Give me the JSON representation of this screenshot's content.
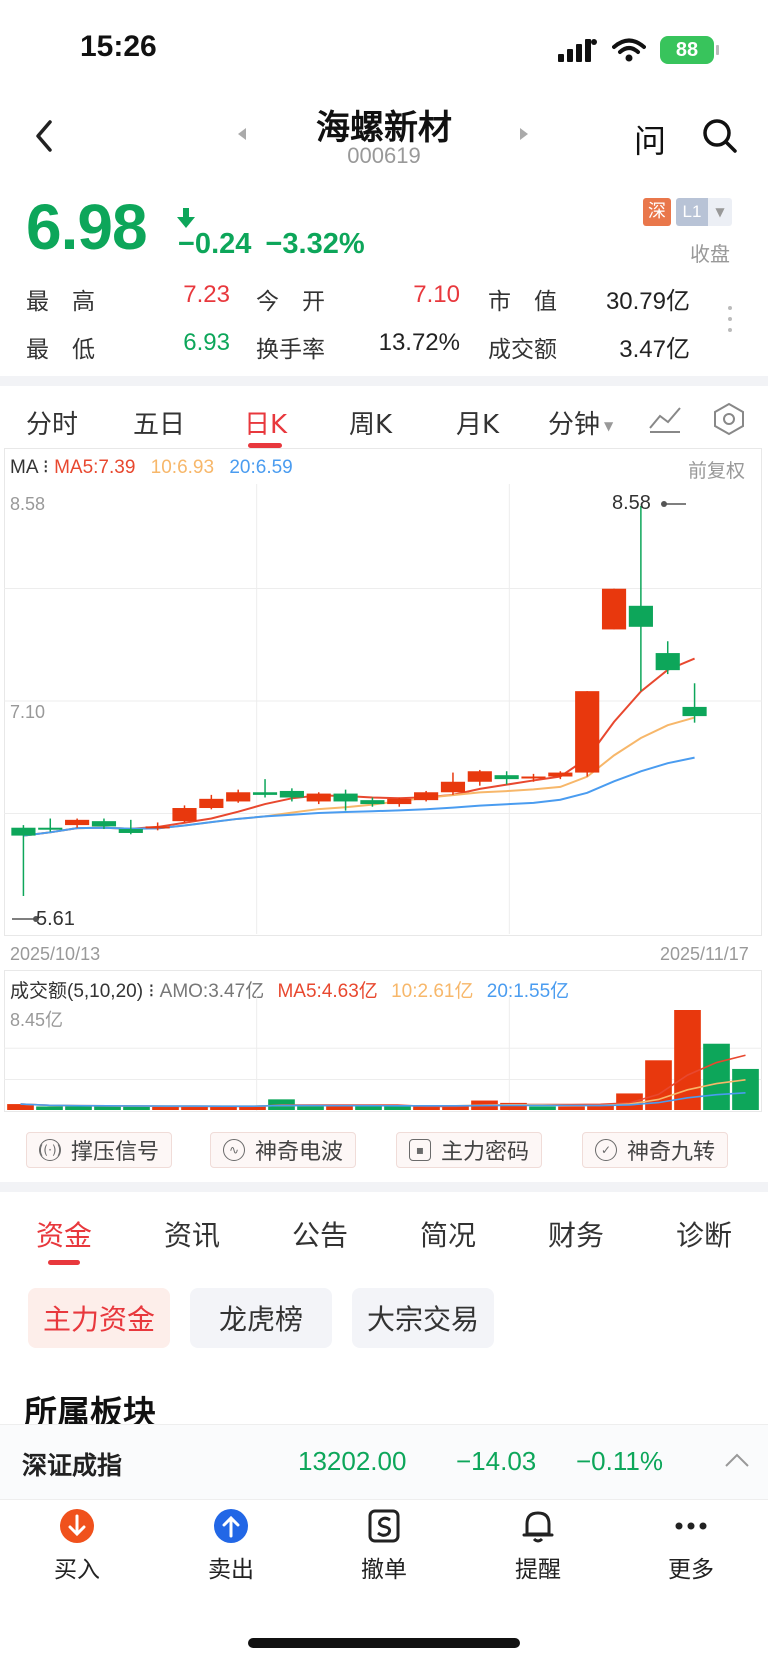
{
  "status_bar": {
    "time": "15:26",
    "battery": "88"
  },
  "nav": {
    "title": "海螺新材",
    "code": "000619",
    "ask_label": "问"
  },
  "quote": {
    "price": "6.98",
    "change": "−0.24",
    "change_pct": "−3.32%",
    "exchange_badge": "深",
    "level_badge": "L1",
    "status": "收盘",
    "stats": {
      "high_label": "最　高",
      "high": "7.23",
      "open_label": "今　开",
      "open": "7.10",
      "mktcap_label": "市　值",
      "mktcap": "30.79亿",
      "low_label": "最　低",
      "low": "6.93",
      "turnover_label": "换手率",
      "turnover": "13.72%",
      "amount_label": "成交额",
      "amount": "3.47亿"
    }
  },
  "chart_tabs": [
    "分时",
    "五日",
    "日K",
    "周K",
    "月K",
    "分钟"
  ],
  "chart": {
    "ma_label": "MA",
    "ma5": "MA5:7.39",
    "ma10": "10:6.93",
    "ma20": "20:6.59",
    "adjust": "前复权",
    "y_top": "8.58",
    "y_mid": "7.10",
    "max_mark": "8.58",
    "min_mark": "5.61",
    "date_start": "2025/10/13",
    "date_end": "2025/11/17"
  },
  "volume": {
    "title": "成交额(5,10,20)",
    "amo": "AMO:3.47亿",
    "ma5": "MA5:4.63亿",
    "ma10": "10:2.61亿",
    "ma20": "20:1.55亿",
    "y_top": "8.45亿"
  },
  "chips": [
    "撑压信号",
    "神奇电波",
    "主力密码",
    "神奇九转"
  ],
  "section_tabs": [
    "资金",
    "资讯",
    "公告",
    "简况",
    "财务",
    "诊断"
  ],
  "sub_tabs": [
    "主力资金",
    "龙虎榜",
    "大宗交易"
  ],
  "section_title": "所属板块",
  "index_bar": {
    "name": "深证成指",
    "value": "13202.00",
    "change": "−14.03",
    "change_pct": "−0.11%"
  },
  "bottom_actions": [
    "买入",
    "卖出",
    "撤单",
    "提醒",
    "更多"
  ],
  "colors": {
    "up": "#e8380d",
    "down": "#0da65a",
    "ma5": "#e8482f",
    "ma10": "#f7b76a",
    "ma20": "#4a9cf0"
  },
  "chart_data": {
    "type": "candlestick",
    "x_start": "2025/10/13",
    "x_end": "2025/11/17",
    "ylim": [
      5.61,
      8.58
    ],
    "candles": [
      {
        "o": 6.13,
        "c": 6.07,
        "h": 6.15,
        "l": 5.61,
        "dir": "down"
      },
      {
        "o": 6.13,
        "c": 6.12,
        "h": 6.2,
        "l": 6.1,
        "dir": "down"
      },
      {
        "o": 6.15,
        "c": 6.19,
        "h": 6.2,
        "l": 6.13,
        "dir": "up"
      },
      {
        "o": 6.18,
        "c": 6.14,
        "h": 6.2,
        "l": 6.12,
        "dir": "down"
      },
      {
        "o": 6.12,
        "c": 6.09,
        "h": 6.19,
        "l": 6.08,
        "dir": "down"
      },
      {
        "o": 6.13,
        "c": 6.14,
        "h": 6.17,
        "l": 6.11,
        "dir": "up"
      },
      {
        "o": 6.18,
        "c": 6.28,
        "h": 6.3,
        "l": 6.17,
        "dir": "up"
      },
      {
        "o": 6.28,
        "c": 6.35,
        "h": 6.38,
        "l": 6.27,
        "dir": "up"
      },
      {
        "o": 6.33,
        "c": 6.4,
        "h": 6.42,
        "l": 6.32,
        "dir": "up"
      },
      {
        "o": 6.4,
        "c": 6.38,
        "h": 6.5,
        "l": 6.36,
        "dir": "down"
      },
      {
        "o": 6.41,
        "c": 6.36,
        "h": 6.43,
        "l": 6.33,
        "dir": "down"
      },
      {
        "o": 6.33,
        "c": 6.39,
        "h": 6.4,
        "l": 6.31,
        "dir": "up"
      },
      {
        "o": 6.39,
        "c": 6.33,
        "h": 6.42,
        "l": 6.26,
        "dir": "down"
      },
      {
        "o": 6.31,
        "c": 6.34,
        "h": 6.36,
        "l": 6.29,
        "dir": "down"
      },
      {
        "o": 6.31,
        "c": 6.35,
        "h": 6.36,
        "l": 6.29,
        "dir": "up"
      },
      {
        "o": 6.34,
        "c": 6.4,
        "h": 6.41,
        "l": 6.33,
        "dir": "up"
      },
      {
        "o": 6.4,
        "c": 6.48,
        "h": 6.55,
        "l": 6.38,
        "dir": "up"
      },
      {
        "o": 6.48,
        "c": 6.56,
        "h": 6.57,
        "l": 6.45,
        "dir": "up"
      },
      {
        "o": 6.53,
        "c": 6.5,
        "h": 6.56,
        "l": 6.46,
        "dir": "down"
      },
      {
        "o": 6.52,
        "c": 6.51,
        "h": 6.54,
        "l": 6.48,
        "dir": "up"
      },
      {
        "o": 6.52,
        "c": 6.55,
        "h": 6.56,
        "l": 6.5,
        "dir": "up"
      },
      {
        "o": 6.55,
        "c": 7.17,
        "h": 7.17,
        "l": 6.52,
        "dir": "up"
      },
      {
        "o": 7.64,
        "c": 7.95,
        "h": 7.95,
        "l": 7.64,
        "dir": "up"
      },
      {
        "o": 7.82,
        "c": 7.66,
        "h": 8.58,
        "l": 7.17,
        "dir": "down"
      },
      {
        "o": 7.46,
        "c": 7.33,
        "h": 7.55,
        "l": 7.3,
        "dir": "down"
      },
      {
        "o": 7.05,
        "c": 6.98,
        "h": 7.23,
        "l": 6.93,
        "dir": "down"
      }
    ],
    "volume_ylim": [
      0,
      8.45
    ],
    "volume_unit": "亿",
    "volume": [
      0.5,
      0.3,
      0.3,
      0.3,
      0.3,
      0.3,
      0.3,
      0.3,
      0.3,
      0.9,
      0.3,
      0.3,
      0.3,
      0.3,
      0.3,
      0.3,
      0.8,
      0.6,
      0.3,
      0.3,
      0.4,
      1.4,
      4.2,
      8.45,
      5.6,
      3.47
    ],
    "volume_dir": [
      "up",
      "down",
      "down",
      "down",
      "down",
      "up",
      "up",
      "up",
      "up",
      "down",
      "down",
      "up",
      "down",
      "down",
      "up",
      "up",
      "up",
      "up",
      "down",
      "up",
      "up",
      "up",
      "up",
      "up",
      "down",
      "down"
    ]
  }
}
